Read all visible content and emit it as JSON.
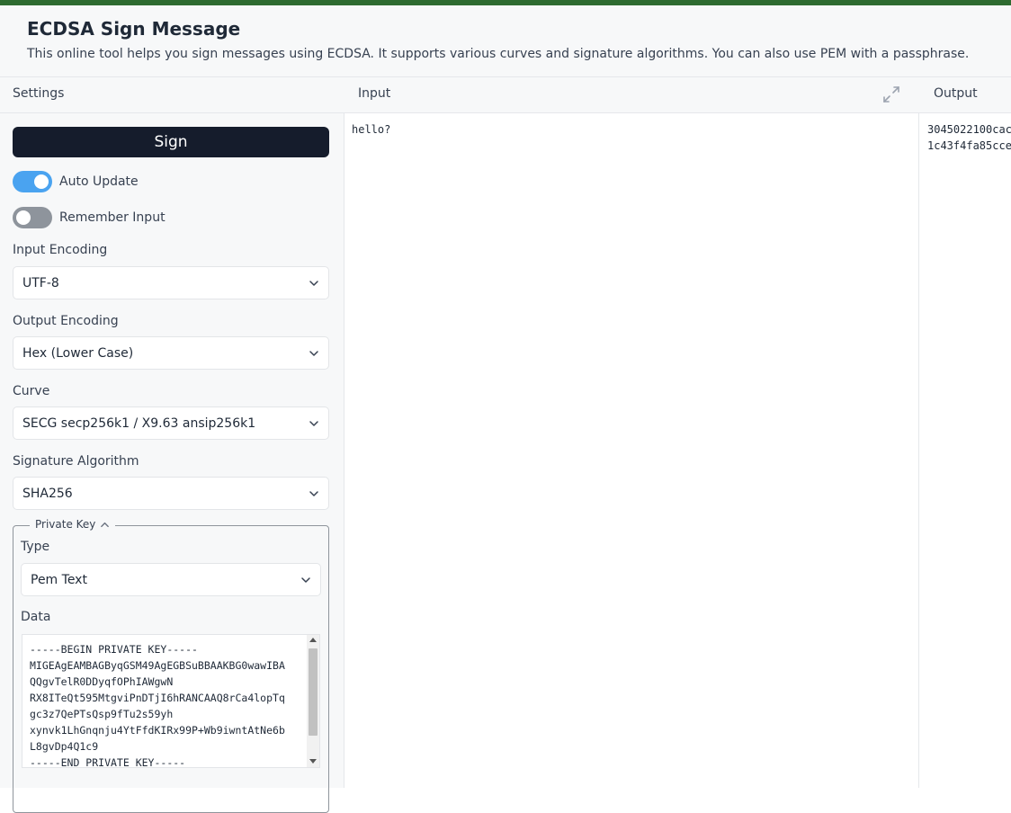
{
  "header": {
    "title": "ECDSA Sign Message",
    "description": "This online tool helps you sign messages using ECDSA. It supports various curves and signature algorithms. You can also use PEM with a passphrase."
  },
  "columns": {
    "settings": "Settings",
    "input": "Input",
    "output": "Output"
  },
  "settings": {
    "sign_label": "Sign",
    "auto_update": {
      "label": "Auto Update",
      "enabled": true
    },
    "remember_input": {
      "label": "Remember Input",
      "enabled": false
    },
    "input_encoding": {
      "label": "Input Encoding",
      "value": "UTF-8"
    },
    "output_encoding": {
      "label": "Output Encoding",
      "value": "Hex (Lower Case)"
    },
    "curve": {
      "label": "Curve",
      "value": "SECG secp256k1 / X9.63 ansip256k1"
    },
    "signature_algorithm": {
      "label": "Signature Algorithm",
      "value": "SHA256"
    },
    "private_key": {
      "legend": "Private Key",
      "type_label": "Type",
      "type_value": "Pem Text",
      "data_label": "Data",
      "data_value": "-----BEGIN PRIVATE KEY-----\nMIGEAgEAMBAGByqGSM49AgEGBSuBBAAKBG0wawIBA\nQQgvTelR0DDyqfOPhIAWgwN\nRX8ITeQt595MtgviPnDTjI6hRANCAAQ8rCa4lopTq\ngc3z7QePTsQsp9fTu2s59yh\nxynvk1LhGnqnju4YtFfdKIRx99P+Wb9iwntAtNe6b\nL8gvDp4Q1c9\n-----END PRIVATE KEY-----"
    }
  },
  "input": {
    "text": "hello?"
  },
  "output": {
    "text": "3045022100cac\n1c43f4fa85cce"
  },
  "colors": {
    "accent_bar": "#2e6b30",
    "sign_button": "#151c2c",
    "toggle_on": "#4aa3f0",
    "toggle_off": "#8e949c"
  },
  "icons": [
    "expand-icon",
    "chevron-down-icon",
    "chevron-up-icon"
  ]
}
